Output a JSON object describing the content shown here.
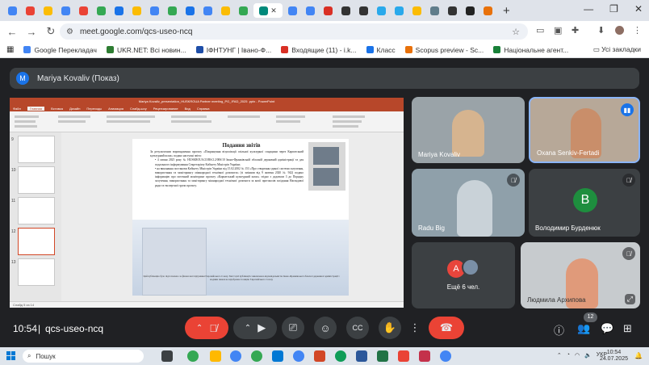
{
  "browser": {
    "tab_count_icons": [
      "google-icon",
      "gmail-icon",
      "meet-icon",
      "docs-icon",
      "drive-icon",
      "telegram-icon",
      "photos-icon",
      "tiktok-icon",
      "maps-icon"
    ],
    "url": "meet.google.com/qcs-useo-ncq",
    "bookmarks": [
      {
        "label": "Google Перекладач",
        "color": "#4285f4"
      },
      {
        "label": "UKR.NET: Всі новин...",
        "color": "#2e7d32"
      },
      {
        "label": "ІФНТУНГ | Івано-Ф...",
        "color": "#1e4ea8"
      },
      {
        "label": "Входящие (11) - i.k...",
        "color": "#d93025"
      },
      {
        "label": "Класс",
        "color": "#1a73e8"
      },
      {
        "label": "Scopus preview - Sc...",
        "color": "#e8710a"
      },
      {
        "label": "Національне агент...",
        "color": "#188038"
      }
    ],
    "all_bookmarks": "Усі закладки"
  },
  "meet": {
    "presenter_initial": "M",
    "presenter_label": "Mariya Kovaliv (Показ)",
    "time": "10:54",
    "separator": "|",
    "code": "qcs-useo-ncq",
    "people_count": "12",
    "participants": [
      {
        "name": "Mariya Kovaliv",
        "type": "video",
        "muted": false
      },
      {
        "name": "Oxana Senkiv-Fertadi",
        "type": "video",
        "speaking": true
      },
      {
        "name": "Radu Big",
        "type": "video",
        "muted": true
      },
      {
        "name": "Володимир Бурденюк",
        "type": "avatar",
        "initial": "В",
        "color": "#1e8e3e",
        "muted": true
      },
      {
        "name": "Ещё 6 чел.",
        "type": "more",
        "initial": "A",
        "color": "#e8453c"
      },
      {
        "name": "Людмила Архипова",
        "type": "video",
        "muted": true
      }
    ]
  },
  "slide": {
    "window_title": "Mariya Kovaliv_presentation_HUSKROUA Partner meeting_PG_IFAD_2025 .pptx - PowerPoint",
    "ribbon_tabs": [
      "Файл",
      "Главная",
      "Вставка",
      "Дизайн",
      "Переходы",
      "Анимация",
      "Слайд-шоу",
      "Рецензирование",
      "Вид",
      "Справка"
    ],
    "title": "Подання звітів",
    "intro": "За результатами впровадження проєкту «Покращення візуалізації спільної культурної спадщини через Карпатський культурний шлях» подано наступні звіти:",
    "bullet1": "4 липня 2025 року № HUSKROUA/23/RS/2.2/006/10 Івано-Франківській обласній державній адміністрації та для подальшого інформування Секретаріату Кабінету Міністрів України;",
    "bullet2": "на виконання постанови Кабінету Міністрів України від 15.02.2002 № 153 «Про створення єдиної системи залучення, використання та моніторингу міжнародної технічної допомоги» (зі змінами від 9 жовтня 2020 № 942) подано інформацію про поточний моніторинг проєкту «Карпатський культурний шлях» згідно з додатком 3 до Порядку залучення, використання та моніторингу міжнародної технічної допомоги за копії протоколів засідання Наглядової ради та експертної групи проєкту.",
    "footer": "Цей публікацію було підготовлено за фінансової підтримки Європейського Союзу. Зміст цієї публікації є виключною відповідальністю Івано-Франківської обласної державної адміністрації і жодним чином не відображає позицію Європейського Союзу",
    "status": "Слайд 5 из 14",
    "thumb_numbers": [
      "9",
      "10",
      "11",
      "12",
      "13"
    ]
  },
  "taskbar": {
    "search_placeholder": "Пошук",
    "lang": "УКР",
    "time": "10:54",
    "date": "24.07.2025"
  }
}
